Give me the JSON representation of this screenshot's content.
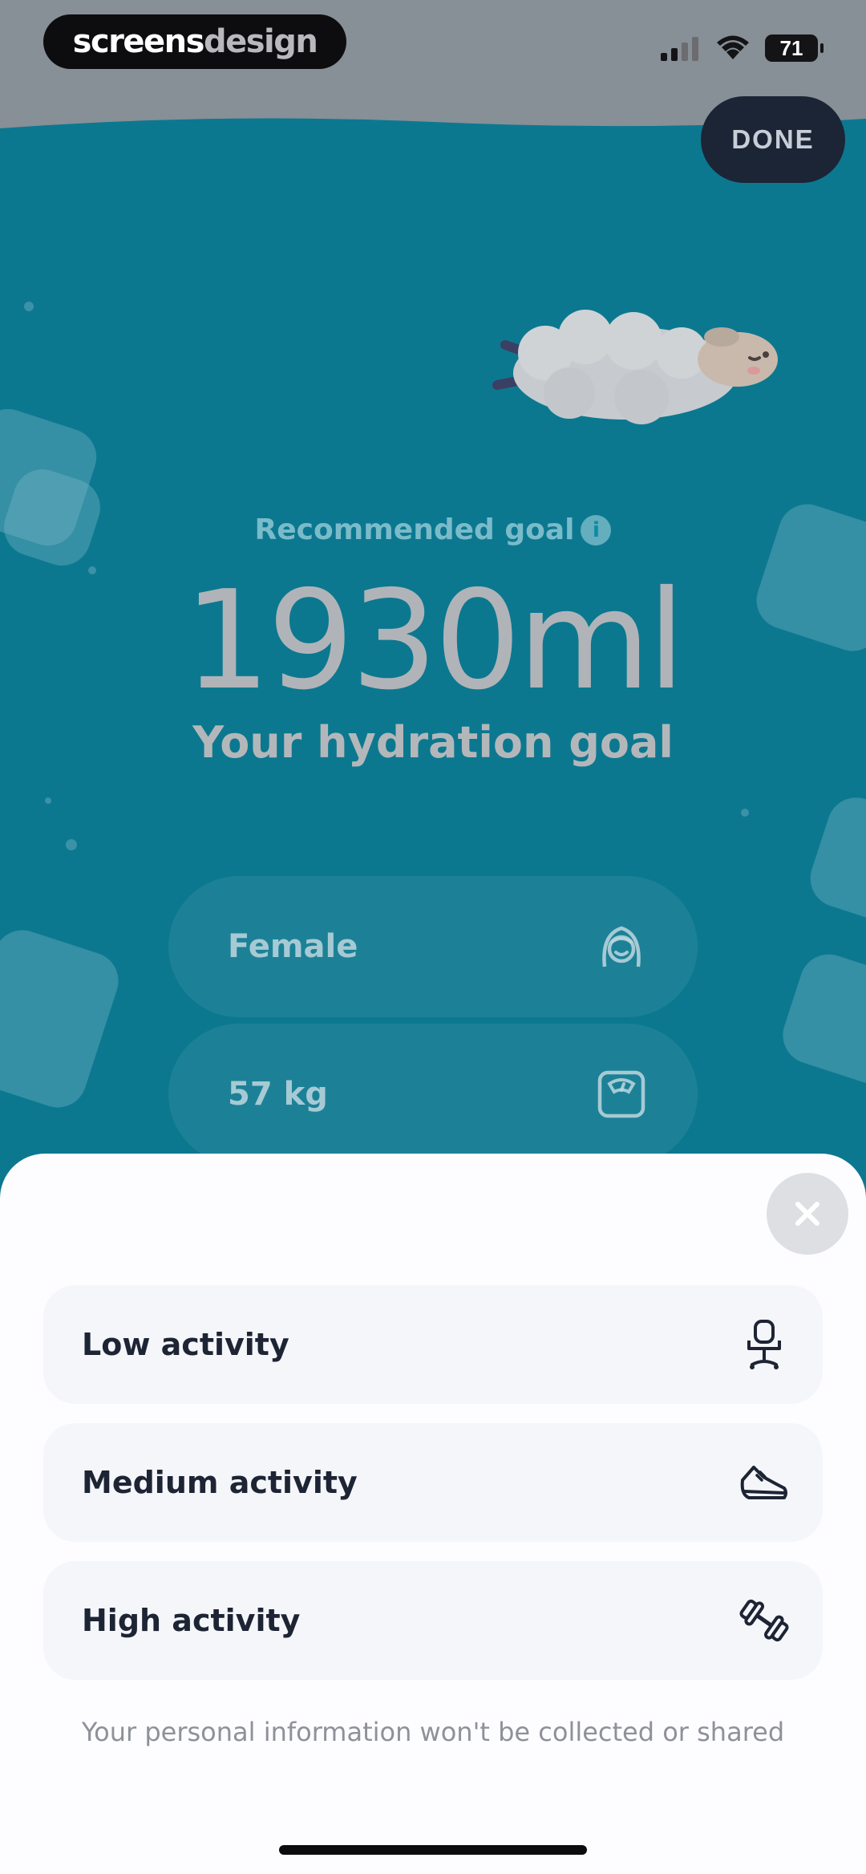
{
  "status_bar": {
    "brand_part1": "screens",
    "brand_part2": "design",
    "battery": "71"
  },
  "header": {
    "done_label": "DONE"
  },
  "goal": {
    "recommended_label": "Recommended goal",
    "info_glyph": "i",
    "value": "1930ml",
    "caption": "Your hydration goal"
  },
  "fields": [
    {
      "label": "Female",
      "icon": "woman-face-icon"
    },
    {
      "label": "57 kg",
      "icon": "scale-icon"
    }
  ],
  "sheet": {
    "options": [
      {
        "label": "Low activity",
        "icon": "office-chair-icon"
      },
      {
        "label": "Medium activity",
        "icon": "sneaker-icon"
      },
      {
        "label": "High activity",
        "icon": "dumbbell-icon"
      }
    ],
    "privacy_note": "Your personal information won't be collected or shared"
  },
  "colors": {
    "accent_teal": "#0e8aa3",
    "done_button": "#1c2535",
    "sheet_bg": "#fdfdff",
    "option_bg": "#f5f6fa",
    "text_dark": "#1d2434"
  }
}
